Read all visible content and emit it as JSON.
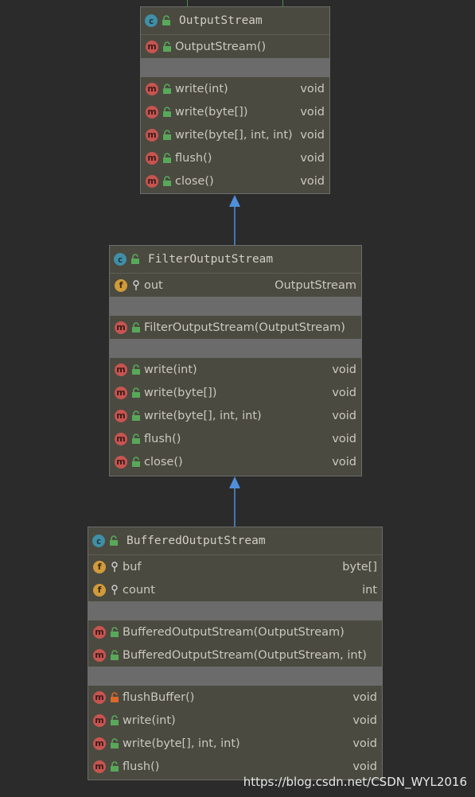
{
  "classes": {
    "output_stream": {
      "badge": "c",
      "name": "OutputStream",
      "constructors": [
        "OutputStream()"
      ],
      "methods": [
        {
          "name": "write(int)",
          "type": "void"
        },
        {
          "name": "write(byte[])",
          "type": "void"
        },
        {
          "name": "write(byte[], int, int)",
          "type": "void"
        },
        {
          "name": "flush()",
          "type": "void"
        },
        {
          "name": "close()",
          "type": "void"
        }
      ]
    },
    "filter_output_stream": {
      "badge": "c",
      "name": "FilterOutputStream",
      "fields": [
        {
          "name": "out",
          "type": "OutputStream"
        }
      ],
      "constructors": [
        "FilterOutputStream(OutputStream)"
      ],
      "methods": [
        {
          "name": "write(int)",
          "type": "void"
        },
        {
          "name": "write(byte[])",
          "type": "void"
        },
        {
          "name": "write(byte[], int, int)",
          "type": "void"
        },
        {
          "name": "flush()",
          "type": "void"
        },
        {
          "name": "close()",
          "type": "void"
        }
      ]
    },
    "buffered_output_stream": {
      "badge": "c",
      "name": "BufferedOutputStream",
      "fields": [
        {
          "name": "buf",
          "type": "byte[]"
        },
        {
          "name": "count",
          "type": "int"
        }
      ],
      "constructors": [
        "BufferedOutputStream(OutputStream)",
        "BufferedOutputStream(OutputStream, int)"
      ],
      "methods": [
        {
          "name": "flushBuffer()",
          "type": "void"
        },
        {
          "name": "write(int)",
          "type": "void"
        },
        {
          "name": "write(byte[], int, int)",
          "type": "void"
        },
        {
          "name": "flush()",
          "type": "void"
        }
      ]
    }
  },
  "badges": {
    "class": "c",
    "method": "m",
    "field": "f"
  },
  "colors": {
    "background": "#2b2b2b",
    "box": "#4a4a40",
    "arrow": "#4f8fdc",
    "public_lock": "#59a85a",
    "private_lock": "#d9692a"
  },
  "watermark": "https://blog.csdn.net/CSDN_WYL2016"
}
